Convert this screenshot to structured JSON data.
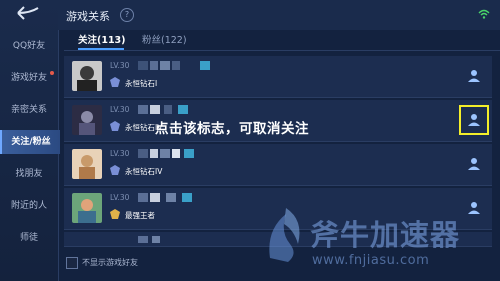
{
  "sidebar": {
    "items": [
      {
        "label": "QQ好友"
      },
      {
        "label": "游戏好友"
      },
      {
        "label": "亲密关系"
      },
      {
        "label": "关注/粉丝"
      },
      {
        "label": "找朋友"
      },
      {
        "label": "附近的人"
      },
      {
        "label": "师徒"
      }
    ]
  },
  "header": {
    "title": "游戏关系"
  },
  "tabs": [
    {
      "label": "关注(113)"
    },
    {
      "label": "粉丝(122)"
    }
  ],
  "rows": [
    {
      "level": "LV.30",
      "rank": "永恒钻石I"
    },
    {
      "level": "LV.30",
      "rank": "永恒钻石IV"
    },
    {
      "level": "LV.30",
      "rank": "永恒钻石IV"
    },
    {
      "level": "LV.30",
      "rank": "最强王者"
    }
  ],
  "annotation": "点击该标志，可取消关注",
  "footer": {
    "checkbox_label": "不显示游戏好友"
  },
  "watermark": {
    "text": "斧牛加速器",
    "url": "www.fnjiasu.com"
  },
  "colors": {
    "accent": "#4d9fff",
    "highlight": "#f4ee2a",
    "background": "#13223f"
  }
}
